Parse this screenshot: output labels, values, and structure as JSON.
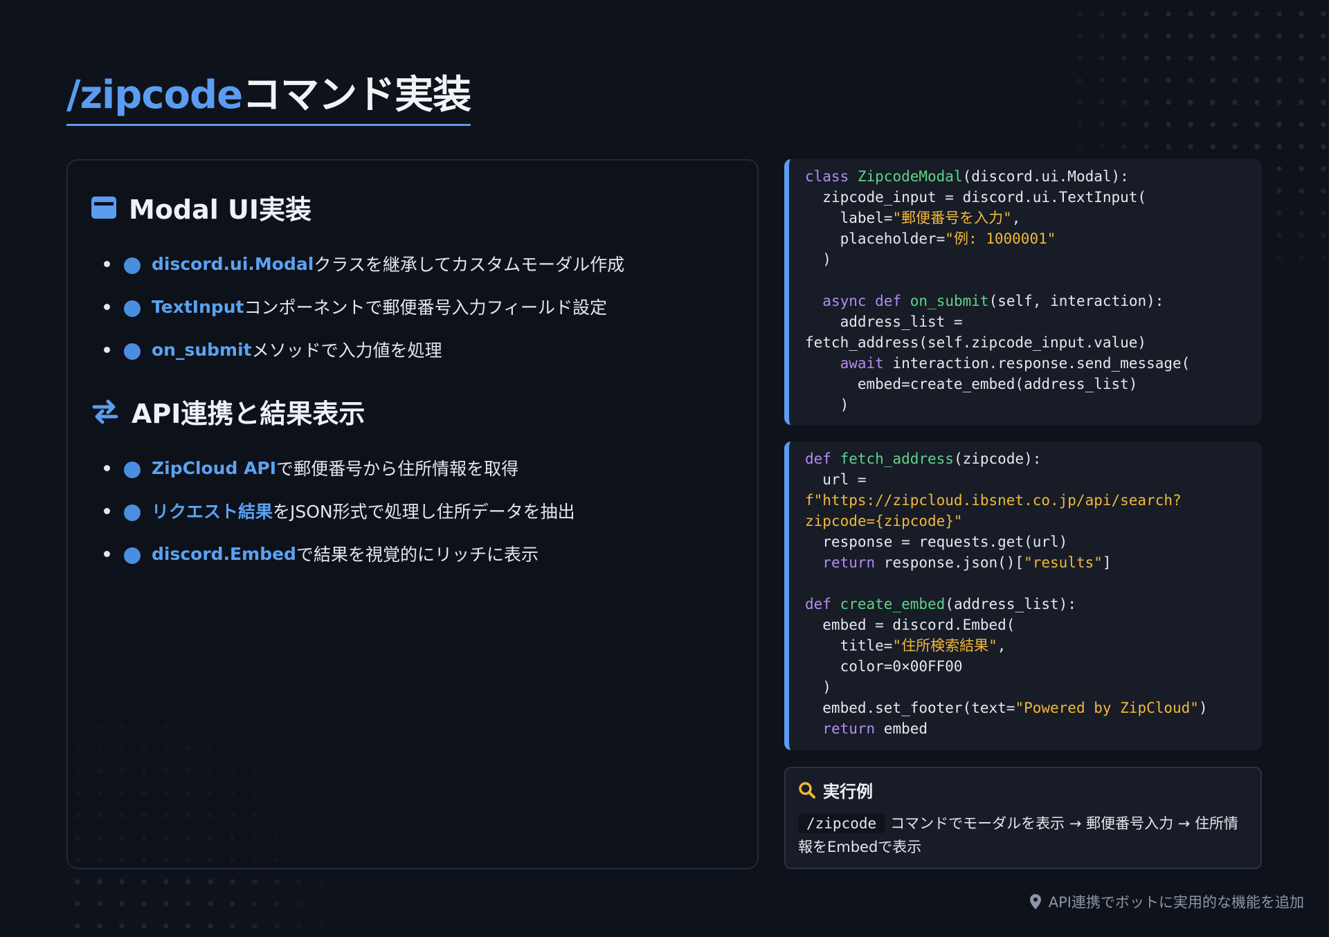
{
  "title": {
    "accent": "/zipcode",
    "rest": "コマンド実装"
  },
  "left": {
    "modal_heading": "Modal UI実装",
    "modal_items": [
      {
        "kw": "discord.ui.Modal",
        "text": "クラスを継承してカスタムモーダル作成"
      },
      {
        "kw": "TextInput",
        "text": "コンポーネントで郵便番号入力フィールド設定"
      },
      {
        "kw": "on_submit",
        "text": "メソッドで入力値を処理"
      }
    ],
    "api_heading": "API連携と結果表示",
    "api_items": [
      {
        "kw": "ZipCloud API",
        "text": "で郵便番号から住所情報を取得"
      },
      {
        "kw": "リクエスト結果",
        "text": "をJSON形式で処理し住所データを抽出"
      },
      {
        "kw": "discord.Embed",
        "text": "で結果を視覚的にリッチに表示"
      }
    ]
  },
  "code1": {
    "l1_kw": "class",
    "l1_name": "ZipcodeModal",
    "l1_rest": "(discord.ui.Modal):",
    "l2": "  zipcode_input = discord.ui.TextInput(",
    "l3_a": "    label=",
    "l3_s": "\"郵便番号を入力\"",
    "l3_b": ",",
    "l4_a": "    placeholder=",
    "l4_s": "\"例: 1000001\"",
    "l5": "  )",
    "l7_kw1": "async",
    "l7_kw2": "def",
    "l7_fn": "on_submit",
    "l7_rest": "(self, interaction):",
    "l8": "    address_list =",
    "l9": "fetch_address(self.zipcode_input.value)",
    "l10_kw": "await",
    "l10_rest": " interaction.response.send_message(",
    "l11": "      embed=create_embed(address_list)",
    "l12": "    )"
  },
  "code2": {
    "l1_kw": "def",
    "l1_fn": "fetch_address",
    "l1_rest": "(zipcode):",
    "l2": "  url =",
    "l3": "f\"https://zipcloud.ibsnet.co.jp/api/search?",
    "l4": "zipcode={zipcode}\"",
    "l5": "  response = requests.get(url)",
    "l6_kw": "return",
    "l6_a": " response.json()[",
    "l6_s": "\"results\"",
    "l6_b": "]",
    "l8_kw": "def",
    "l8_fn": "create_embed",
    "l8_rest": "(address_list):",
    "l9": "  embed = discord.Embed(",
    "l10_a": "    title=",
    "l10_s": "\"住所検索結果\"",
    "l10_b": ",",
    "l11": "    color=0×00FF00",
    "l12": "  )",
    "l13_a": "  embed.set_footer(text=",
    "l13_s": "\"Powered by ZipCloud\"",
    "l13_b": ")",
    "l14_kw": "return",
    "l14_rest": " embed"
  },
  "example": {
    "heading": "実行例",
    "cmd": "/zipcode",
    "text": "コマンドでモーダルを表示 → 郵便番号入力 → 住所情報をEmbedで表示"
  },
  "footer": {
    "text": "API連携でボットに実用的な機能を追加"
  },
  "colors": {
    "accent": "#5b9cf0",
    "keyword": "#b48bf2",
    "function": "#5fd389",
    "string": "#f3b83a",
    "background": "#0e121a"
  },
  "icons": {
    "modal": "window-icon",
    "api": "swap-arrows-icon",
    "example": "search-icon",
    "footer": "map-pin-icon"
  }
}
